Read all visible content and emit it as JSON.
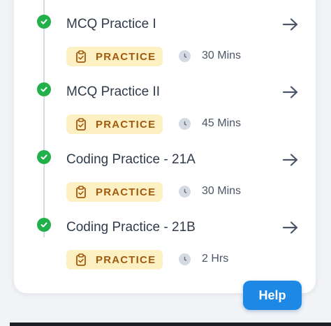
{
  "items": [
    {
      "title": "MCQ Practice I",
      "badge": "PRACTICE",
      "duration": "30 Mins",
      "completed": true
    },
    {
      "title": "MCQ Practice II",
      "badge": "PRACTICE",
      "duration": "45 Mins",
      "completed": true
    },
    {
      "title": "Coding Practice - 21A",
      "badge": "PRACTICE",
      "duration": "30 Mins",
      "completed": true
    },
    {
      "title": "Coding Practice - 21B",
      "badge": "PRACTICE",
      "duration": "2 Hrs",
      "completed": true
    }
  ],
  "help_button": {
    "label": "Help"
  },
  "colors": {
    "check": "#22b04b",
    "badge_bg": "#fdf0c2",
    "badge_text": "#a05a10",
    "help_bg": "#1e88e5",
    "arrow": "#4a5568"
  },
  "icons": {
    "completed": "check-icon",
    "badge": "clipboard-icon",
    "duration": "clock-icon",
    "open": "arrow-right-icon"
  }
}
